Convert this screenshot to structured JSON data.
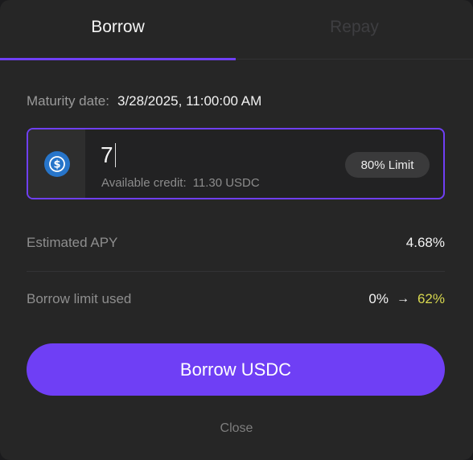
{
  "tabs": {
    "borrow": "Borrow",
    "repay": "Repay"
  },
  "maturity": {
    "label": "Maturity date:",
    "value": "3/28/2025, 11:00:00 AM"
  },
  "input": {
    "value": "7",
    "token_icon": "usdc-dollar-icon",
    "credit_label": "Available credit:",
    "credit_value": "11.30 USDC",
    "limit_button": "80% Limit"
  },
  "stats": {
    "apy_label": "Estimated APY",
    "apy_value": "4.68%",
    "limit_label": "Borrow limit used",
    "limit_from": "0%",
    "limit_arrow": "→",
    "limit_to": "62%"
  },
  "actions": {
    "borrow_label": "Borrow USDC",
    "close_label": "Close"
  },
  "colors": {
    "accent": "#6f3ff5",
    "highlight": "#d8d84f",
    "usdc": "#2775ca"
  }
}
